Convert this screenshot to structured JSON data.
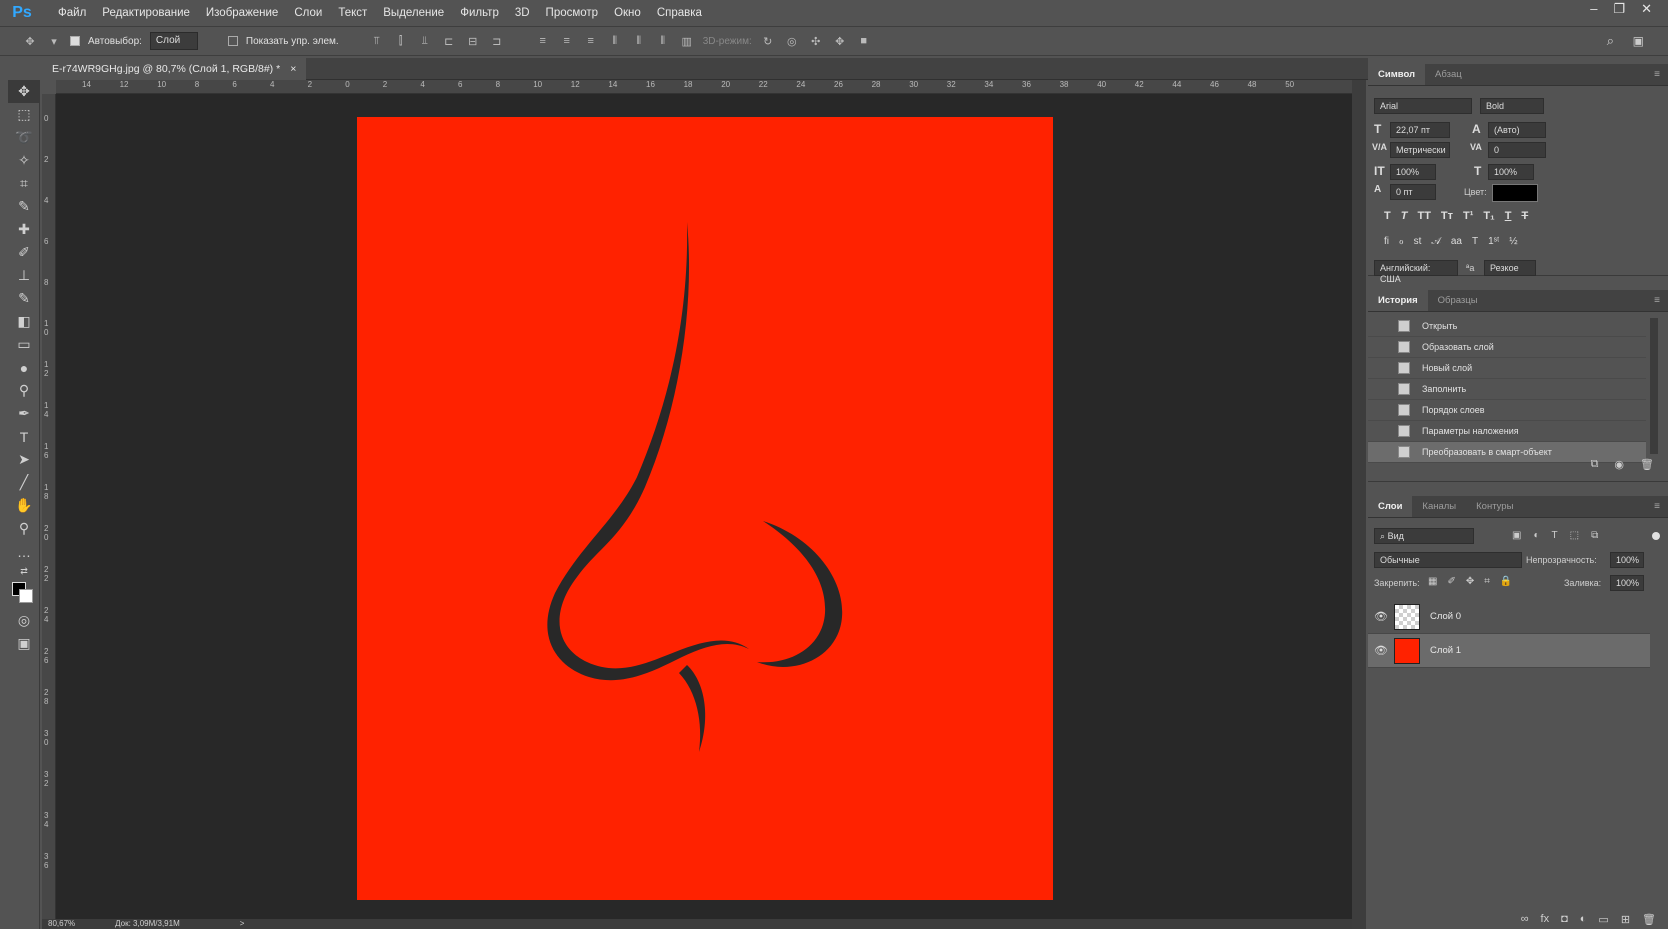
{
  "app": {
    "logo": "Ps"
  },
  "menu": [
    "Файл",
    "Редактирование",
    "Изображение",
    "Слои",
    "Текст",
    "Выделение",
    "Фильтр",
    "3D",
    "Просмотр",
    "Окно",
    "Справка"
  ],
  "window_controls": {
    "minimize": "–",
    "restore": "❐",
    "close": "✕"
  },
  "options_bar": {
    "autoselect_label": "Автовыбор:",
    "autoselect_value": "Слой",
    "show_transform_label": "Показать упр. элем.",
    "mode_3d_label": "3D-режим:"
  },
  "document": {
    "tab_title": "E-r74WR9GHg.jpg @ 80,7% (Слой 1, RGB/8#) *",
    "close": "×",
    "canvas_color": "#ff2200",
    "stroke_color": "#282828"
  },
  "ruler_h": [
    "14",
    "12",
    "10",
    "8",
    "6",
    "4",
    "2",
    "0",
    "2",
    "4",
    "6",
    "8",
    "10",
    "12",
    "14",
    "16",
    "18",
    "20",
    "22",
    "24",
    "26",
    "28",
    "30",
    "32",
    "34",
    "36",
    "38",
    "40",
    "42",
    "44",
    "46",
    "48",
    "50"
  ],
  "ruler_v": [
    "0",
    "2",
    "4",
    "6",
    "8",
    "1 0",
    "1 2",
    "1 4",
    "1 6",
    "1 8",
    "2 0",
    "2 2",
    "2 4",
    "2 6",
    "2 8",
    "3 0",
    "3 2",
    "3 4",
    "3 6"
  ],
  "status": {
    "zoom": "80,67%",
    "doc": "Док: 3,09M/3,91M",
    "arrow": ">"
  },
  "character_panel": {
    "tabs": [
      "Символ",
      "Абзац"
    ],
    "font_family": "Arial",
    "font_style": "Bold",
    "font_size": "22,07 пт",
    "leading": "(Авто)",
    "kerning": "Метрически",
    "tracking": "0",
    "vscale": "100%",
    "hscale": "100%",
    "baseline": "0 пт",
    "color_label": "Цвет:",
    "color_value": "#000000",
    "language": "Английский: США",
    "antialias": "Резкое"
  },
  "history_panel": {
    "tabs": [
      "История",
      "Образцы"
    ],
    "items": [
      "Открыть",
      "Образовать слой",
      "Новый слой",
      "Заполнить",
      "Порядок слоев",
      "Параметры наложения",
      "Преобразовать в смарт-объект"
    ]
  },
  "layers_panel": {
    "tabs": [
      "Слои",
      "Каналы",
      "Контуры"
    ],
    "filter_label": "Вид",
    "blend_mode": "Обычные",
    "opacity_label": "Непрозрачность:",
    "opacity_value": "100%",
    "lock_label": "Закрепить:",
    "fill_label": "Заливка:",
    "fill_value": "100%",
    "layers": [
      {
        "name": "Слой 0",
        "thumb": "checker"
      },
      {
        "name": "Слой 1",
        "thumb": "red"
      }
    ]
  }
}
